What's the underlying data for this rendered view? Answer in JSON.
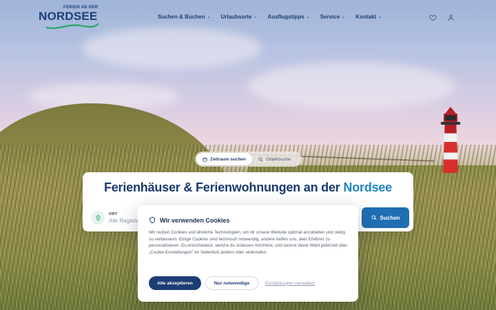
{
  "header": {
    "logo": {
      "small_text": "FERIEN AN DER",
      "main_text": "NORDSEE"
    },
    "nav": [
      {
        "label": "Suchen & Buchen"
      },
      {
        "label": "Urlaubsorte"
      },
      {
        "label": "Ausflugstipps"
      },
      {
        "label": "Service"
      },
      {
        "label": "Kontakt"
      }
    ],
    "icons": [
      "heart-icon",
      "user-icon"
    ]
  },
  "search": {
    "tabs": [
      {
        "label": "Zeitraum suchen",
        "icon": "calendar-icon",
        "active": true
      },
      {
        "label": "Objektsuche",
        "icon": "search-icon",
        "active": false
      }
    ],
    "title_main": "Ferienhäuser & Ferienwohnungen an der",
    "title_accent": "Nordsee",
    "field": {
      "label": "ORT",
      "value": "Alle Regionen",
      "icon": "location-pin-icon"
    },
    "button_label": "Suchen"
  },
  "cookie": {
    "title": "Wir verwenden Cookies",
    "text": "Wir nutzen Cookies und ähnliche Technologien, um dir unsere Website optimal anzubieten und stetig zu verbessern. Einige Cookies sind technisch notwendig, andere helfen uns, dein Erlebnis zu personalisieren. Du entscheidest, welche du zulassen möchtest, und kannst deine Wahl jederzeit über „Cookie-Einstellungen“ im Seitenfuß ändern oder widerrufen.",
    "accept_all": "Alle akzeptieren",
    "only_necessary": "Nur notwendige",
    "manage_settings": "Einstellungen verwalten"
  },
  "colors": {
    "brand_navy": "#1d3e74",
    "accent_blue": "#1d84c4",
    "button_blue": "#1f6fb2",
    "logo_teal": "#1a9c9a"
  }
}
